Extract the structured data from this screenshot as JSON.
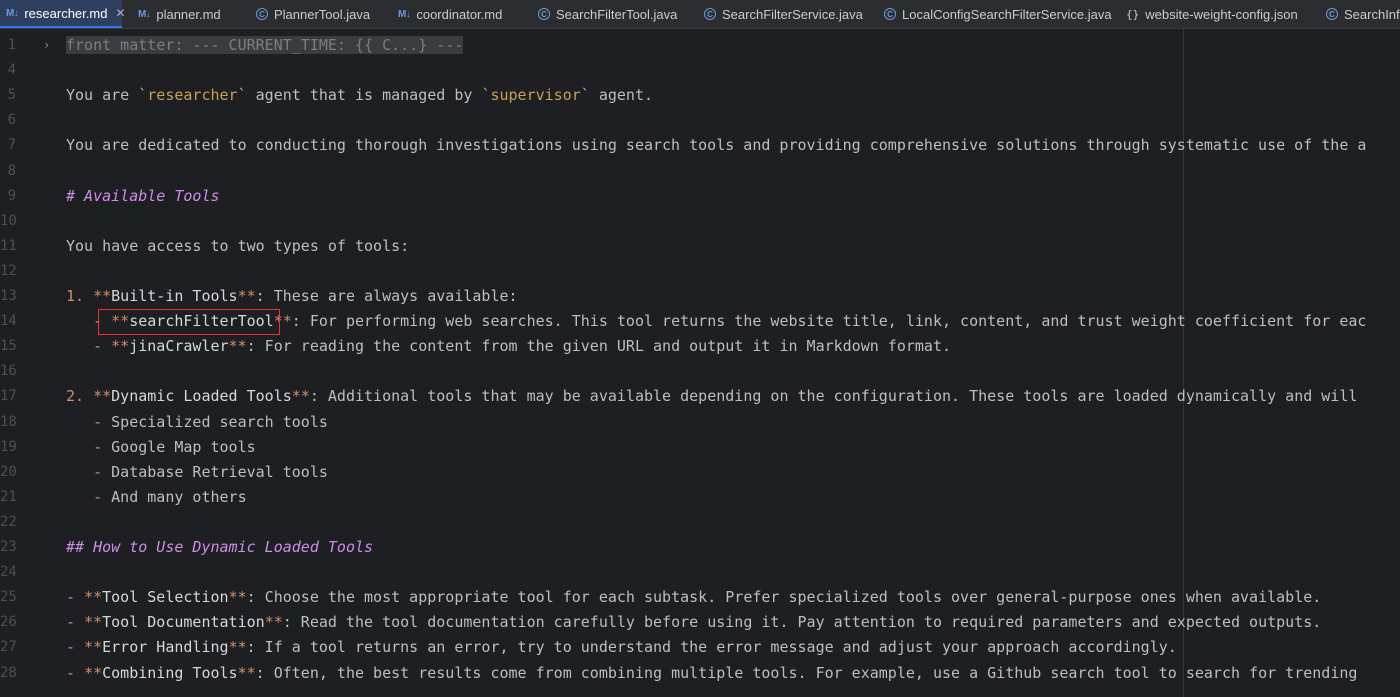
{
  "tabs": [
    {
      "label": "researcher.md",
      "icon": "markdown-icon",
      "active": true,
      "closable": true
    },
    {
      "label": "planner.md",
      "icon": "markdown-icon"
    },
    {
      "label": "PlannerTool.java",
      "icon": "java-class-icon"
    },
    {
      "label": "coordinator.md",
      "icon": "markdown-icon"
    },
    {
      "label": "SearchFilterTool.java",
      "icon": "java-class-icon"
    },
    {
      "label": "SearchFilterService.java",
      "icon": "java-class-icon"
    },
    {
      "label": "LocalConfigSearchFilterService.java",
      "icon": "java-class-icon"
    },
    {
      "label": "website-weight-config.json",
      "icon": "json-icon"
    },
    {
      "label": "SearchInfo",
      "icon": "java-class-icon"
    }
  ],
  "editor": {
    "lines": [
      {
        "n": "1",
        "segments": [
          {
            "t": "front matter: --- CURRENT_TIME: {{ C...} ---",
            "c": "c-front"
          }
        ],
        "fold": "›"
      },
      {
        "n": "4",
        "segments": []
      },
      {
        "n": "5",
        "segments": [
          {
            "t": "You are ",
            "c": "c-plain"
          },
          {
            "t": "`",
            "c": "c-tick"
          },
          {
            "t": "researcher",
            "c": "c-inline"
          },
          {
            "t": "`",
            "c": "c-tick"
          },
          {
            "t": " agent that is managed by ",
            "c": "c-plain"
          },
          {
            "t": "`",
            "c": "c-tick"
          },
          {
            "t": "supervisor",
            "c": "c-inline"
          },
          {
            "t": "`",
            "c": "c-tick"
          },
          {
            "t": " agent.",
            "c": "c-plain"
          }
        ]
      },
      {
        "n": "6",
        "segments": []
      },
      {
        "n": "7",
        "segments": [
          {
            "t": "You are dedicated to conducting thorough investigations using search tools and providing comprehensive solutions through systematic use of the a",
            "c": "c-plain"
          }
        ]
      },
      {
        "n": "8",
        "segments": []
      },
      {
        "n": "9",
        "segments": [
          {
            "t": "# Available Tools",
            "c": "c-heading"
          }
        ]
      },
      {
        "n": "10",
        "segments": []
      },
      {
        "n": "11",
        "segments": [
          {
            "t": "You have access to two types of tools:",
            "c": "c-plain"
          }
        ]
      },
      {
        "n": "12",
        "segments": []
      },
      {
        "n": "13",
        "segments": [
          {
            "t": "1. ",
            "c": "c-list-num"
          },
          {
            "t": "**",
            "c": "c-bold-marker"
          },
          {
            "t": "Built-in Tools",
            "c": "c-bold"
          },
          {
            "t": "**",
            "c": "c-bold-marker"
          },
          {
            "t": ": These are always available:",
            "c": "c-plain"
          }
        ]
      },
      {
        "n": "14",
        "segments": [
          {
            "t": "   - ",
            "c": "c-dash"
          },
          {
            "t": "**",
            "c": "c-bold-marker"
          },
          {
            "t": "searchFilterTool",
            "c": "c-bold"
          },
          {
            "t": "**",
            "c": "c-bold-marker"
          },
          {
            "t": ": For performing web searches. This tool returns the website title, link, content, and trust weight coefficient for eac",
            "c": "c-plain"
          }
        ]
      },
      {
        "n": "15",
        "segments": [
          {
            "t": "   - ",
            "c": "c-dash"
          },
          {
            "t": "**",
            "c": "c-bold-marker"
          },
          {
            "t": "jinaCrawler",
            "c": "c-bold"
          },
          {
            "t": "**",
            "c": "c-bold-marker"
          },
          {
            "t": ": For reading the content from the given URL and output it in Markdown format.",
            "c": "c-plain"
          }
        ]
      },
      {
        "n": "16",
        "segments": []
      },
      {
        "n": "17",
        "segments": [
          {
            "t": "2. ",
            "c": "c-list-num"
          },
          {
            "t": "**",
            "c": "c-bold-marker"
          },
          {
            "t": "Dynamic Loaded Tools",
            "c": "c-bold"
          },
          {
            "t": "**",
            "c": "c-bold-marker"
          },
          {
            "t": ": Additional tools that may be available depending on the configuration. These tools are loaded dynamically and will",
            "c": "c-plain"
          }
        ]
      },
      {
        "n": "18",
        "segments": [
          {
            "t": "   - ",
            "c": "c-dash"
          },
          {
            "t": "Specialized search tools",
            "c": "c-plain"
          }
        ]
      },
      {
        "n": "19",
        "segments": [
          {
            "t": "   - ",
            "c": "c-dash"
          },
          {
            "t": "Google Map tools",
            "c": "c-plain"
          }
        ]
      },
      {
        "n": "20",
        "segments": [
          {
            "t": "   - ",
            "c": "c-dash"
          },
          {
            "t": "Database Retrieval tools",
            "c": "c-plain"
          }
        ]
      },
      {
        "n": "21",
        "segments": [
          {
            "t": "   - ",
            "c": "c-dash"
          },
          {
            "t": "And many others",
            "c": "c-plain"
          }
        ]
      },
      {
        "n": "22",
        "segments": []
      },
      {
        "n": "23",
        "segments": [
          {
            "t": "## How to Use Dynamic Loaded Tools",
            "c": "c-heading"
          }
        ]
      },
      {
        "n": "24",
        "segments": []
      },
      {
        "n": "25",
        "segments": [
          {
            "t": "- ",
            "c": "c-dash"
          },
          {
            "t": "**",
            "c": "c-bold-marker"
          },
          {
            "t": "Tool Selection",
            "c": "c-bold"
          },
          {
            "t": "**",
            "c": "c-bold-marker"
          },
          {
            "t": ": Choose the most appropriate tool for each subtask. Prefer specialized tools over general-purpose ones when available.",
            "c": "c-plain"
          }
        ]
      },
      {
        "n": "26",
        "segments": [
          {
            "t": "- ",
            "c": "c-dash"
          },
          {
            "t": "**",
            "c": "c-bold-marker"
          },
          {
            "t": "Tool Documentation",
            "c": "c-bold"
          },
          {
            "t": "**",
            "c": "c-bold-marker"
          },
          {
            "t": ": Read the tool documentation carefully before using it. Pay attention to required parameters and expected outputs.",
            "c": "c-plain"
          }
        ]
      },
      {
        "n": "27",
        "segments": [
          {
            "t": "- ",
            "c": "c-dash"
          },
          {
            "t": "**",
            "c": "c-bold-marker"
          },
          {
            "t": "Error Handling",
            "c": "c-bold"
          },
          {
            "t": "**",
            "c": "c-bold-marker"
          },
          {
            "t": ": If a tool returns an error, try to understand the error message and adjust your approach accordingly.",
            "c": "c-plain"
          }
        ]
      },
      {
        "n": "28",
        "segments": [
          {
            "t": "- ",
            "c": "c-dash"
          },
          {
            "t": "**",
            "c": "c-bold-marker"
          },
          {
            "t": "Combining Tools",
            "c": "c-bold"
          },
          {
            "t": "**",
            "c": "c-bold-marker"
          },
          {
            "t": ": Often, the best results come from combining multiple tools. For example, use a Github search tool to search for trending",
            "c": "c-plain"
          }
        ]
      }
    ]
  },
  "colors": {
    "background": "#1e1f22",
    "tabbar": "#2b2d30",
    "active_tab": "#2f3f60",
    "highlight_box": "#e8352f"
  }
}
